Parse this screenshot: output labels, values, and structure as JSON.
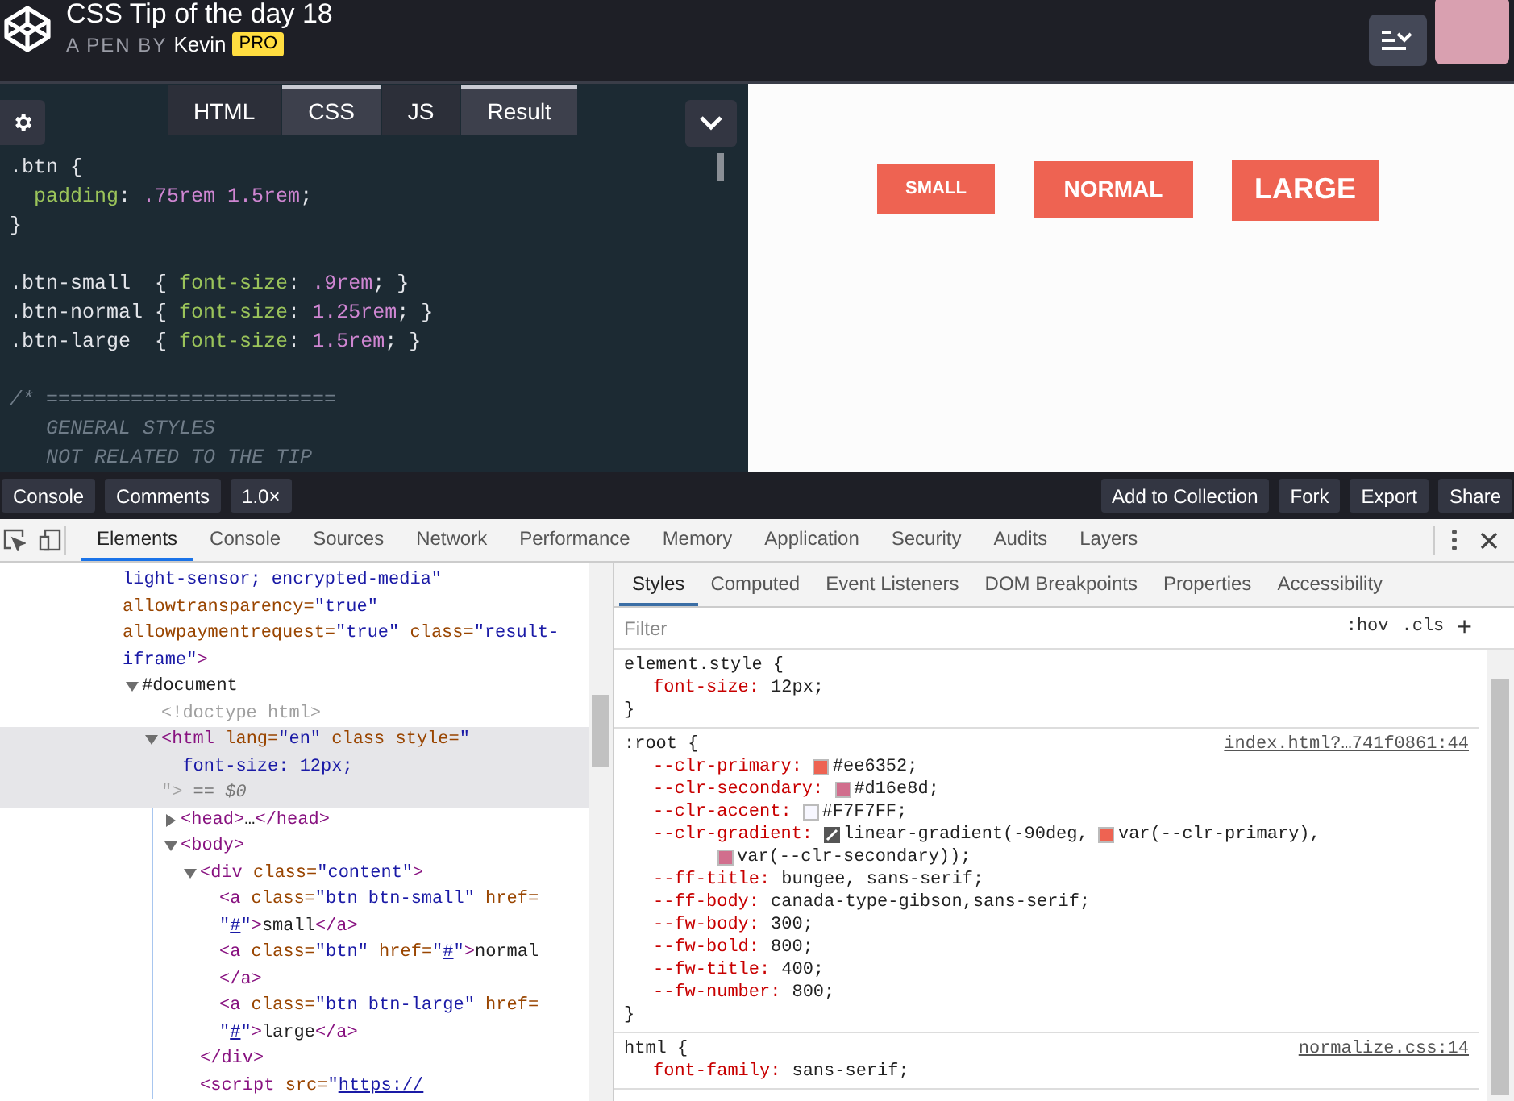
{
  "header": {
    "title": "CSS Tip of the day 18",
    "byline": "A PEN BY",
    "author": "Kevin",
    "badge": "PRO"
  },
  "editor": {
    "tabs": [
      {
        "label": "HTML",
        "selected": false
      },
      {
        "label": "CSS",
        "selected": true
      },
      {
        "label": "JS",
        "selected": false
      },
      {
        "label": "Result",
        "selected": true
      }
    ],
    "code": [
      {
        "tokens": [
          {
            "kind": "sel",
            "text": ".btn "
          },
          {
            "kind": "punct",
            "text": "{"
          }
        ]
      },
      {
        "tokens": [
          {
            "kind": "prop",
            "text": "  padding"
          },
          {
            "kind": "punct",
            "text": ": "
          },
          {
            "kind": "num",
            "text": ".75rem 1.5rem"
          },
          {
            "kind": "punct",
            "text": ";"
          }
        ]
      },
      {
        "tokens": [
          {
            "kind": "punct",
            "text": "}"
          }
        ]
      },
      {
        "kind": "blank"
      },
      {
        "tokens": [
          {
            "kind": "sel",
            "text": ".btn-small  "
          },
          {
            "kind": "punct",
            "text": "{ "
          },
          {
            "kind": "prop",
            "text": "font-size"
          },
          {
            "kind": "punct",
            "text": ": "
          },
          {
            "kind": "num",
            "text": ".9rem"
          },
          {
            "kind": "punct",
            "text": "; }"
          }
        ]
      },
      {
        "tokens": [
          {
            "kind": "sel",
            "text": ".btn-normal "
          },
          {
            "kind": "punct",
            "text": "{ "
          },
          {
            "kind": "prop",
            "text": "font-size"
          },
          {
            "kind": "punct",
            "text": ": "
          },
          {
            "kind": "num",
            "text": "1.25rem"
          },
          {
            "kind": "punct",
            "text": "; }"
          }
        ]
      },
      {
        "tokens": [
          {
            "kind": "sel",
            "text": ".btn-large  "
          },
          {
            "kind": "punct",
            "text": "{ "
          },
          {
            "kind": "prop",
            "text": "font-size"
          },
          {
            "kind": "punct",
            "text": ": "
          },
          {
            "kind": "num",
            "text": "1.5rem"
          },
          {
            "kind": "punct",
            "text": "; }"
          }
        ]
      },
      {
        "kind": "blank"
      },
      {
        "tokens": [
          {
            "kind": "comment",
            "text": "/* ========================"
          }
        ]
      },
      {
        "tokens": [
          {
            "kind": "comment",
            "text": "   GENERAL STYLES"
          }
        ]
      },
      {
        "tokens": [
          {
            "kind": "comment",
            "text": "   NOT RELATED TO THE TIP"
          }
        ]
      }
    ]
  },
  "result": {
    "buttons": [
      {
        "label": "SMALL",
        "kind": "small"
      },
      {
        "label": "NORMAL",
        "kind": "normal"
      },
      {
        "label": "LARGE",
        "kind": "large"
      }
    ]
  },
  "bar": {
    "left": [
      "Console",
      "Comments",
      "1.0×"
    ],
    "right": [
      "Add to Collection",
      "Fork",
      "Export",
      "Share"
    ]
  },
  "devtools": {
    "tabs": [
      {
        "label": "Elements",
        "selected": true
      },
      {
        "label": "Console",
        "selected": false
      },
      {
        "label": "Sources",
        "selected": false
      },
      {
        "label": "Network",
        "selected": false
      },
      {
        "label": "Performance",
        "selected": false
      },
      {
        "label": "Memory",
        "selected": false
      },
      {
        "label": "Application",
        "selected": false
      },
      {
        "label": "Security",
        "selected": false
      },
      {
        "label": "Audits",
        "selected": false
      },
      {
        "label": "Layers",
        "selected": false
      }
    ]
  },
  "elements": {
    "nodes": [
      {
        "lines": [
          [
            {
              "kind": "val",
              "text": "light-sensor; encrypted-media\""
            }
          ],
          [
            {
              "kind": "attr",
              "text": "allowtransparency="
            },
            {
              "kind": "val",
              "text": "\"true\""
            }
          ],
          [
            {
              "kind": "attr",
              "text": "allowpaymentrequest="
            },
            {
              "kind": "val",
              "text": "\"true\""
            },
            {
              "kind": "attr",
              "text": " class="
            },
            {
              "kind": "val",
              "text": "\"result-"
            }
          ],
          [
            {
              "kind": "val",
              "text": "iframe\""
            },
            {
              "kind": "tag",
              "text": ">"
            }
          ]
        ],
        "children": [
          {
            "expanded": true,
            "lines": [
              [
                {
                  "kind": "text",
                  "text": "#document"
                }
              ]
            ],
            "children": [
              {
                "lines": [
                  [
                    {
                      "kind": "dim",
                      "text": "<!doctype html>"
                    }
                  ]
                ]
              },
              {
                "expanded": true,
                "selected": true,
                "lines": [
                  [
                    {
                      "kind": "tag",
                      "text": "<html"
                    },
                    {
                      "kind": "attr",
                      "text": " lang="
                    },
                    {
                      "kind": "val",
                      "text": "\"en\""
                    },
                    {
                      "kind": "attr",
                      "text": " class style="
                    },
                    {
                      "kind": "val",
                      "text": "\""
                    }
                  ],
                  [
                    {
                      "kind": "val",
                      "text": "  font-size: 12px;"
                    }
                  ],
                  [
                    {
                      "kind": "dim",
                      "text": "\">"
                    },
                    {
                      "kind": "meta",
                      "text": " == $0"
                    }
                  ]
                ],
                "children": [
                  {
                    "expanded": false,
                    "lines": [
                      [
                        {
                          "kind": "tag",
                          "text": "<head>"
                        },
                        {
                          "kind": "text",
                          "text": "…"
                        },
                        {
                          "kind": "tag",
                          "text": "</head>"
                        }
                      ]
                    ]
                  },
                  {
                    "expanded": true,
                    "lines": [
                      [
                        {
                          "kind": "tag",
                          "text": "<body>"
                        }
                      ]
                    ],
                    "children": [
                      {
                        "expanded": true,
                        "lines": [
                          [
                            {
                              "kind": "tag",
                              "text": "<div"
                            },
                            {
                              "kind": "attr",
                              "text": " class="
                            },
                            {
                              "kind": "val",
                              "text": "\"content\""
                            },
                            {
                              "kind": "tag",
                              "text": ">"
                            }
                          ]
                        ],
                        "children": [
                          {
                            "lines": [
                              [
                                {
                                  "kind": "tag",
                                  "text": "<a"
                                },
                                {
                                  "kind": "attr",
                                  "text": " class="
                                },
                                {
                                  "kind": "val",
                                  "text": "\"btn btn-small\""
                                },
                                {
                                  "kind": "attr",
                                  "text": " href="
                                }
                              ],
                              [
                                {
                                  "kind": "val",
                                  "text": "\""
                                },
                                {
                                  "kind": "link",
                                  "text": "#"
                                },
                                {
                                  "kind": "val",
                                  "text": "\""
                                },
                                {
                                  "kind": "tag",
                                  "text": ">"
                                },
                                {
                                  "kind": "text",
                                  "text": "small"
                                },
                                {
                                  "kind": "tag",
                                  "text": "</a>"
                                }
                              ]
                            ]
                          },
                          {
                            "lines": [
                              [
                                {
                                  "kind": "tag",
                                  "text": "<a"
                                },
                                {
                                  "kind": "attr",
                                  "text": " class="
                                },
                                {
                                  "kind": "val",
                                  "text": "\"btn\""
                                },
                                {
                                  "kind": "attr",
                                  "text": " href="
                                },
                                {
                                  "kind": "val",
                                  "text": "\""
                                },
                                {
                                  "kind": "link",
                                  "text": "#"
                                },
                                {
                                  "kind": "val",
                                  "text": "\""
                                },
                                {
                                  "kind": "tag",
                                  "text": ">"
                                },
                                {
                                  "kind": "text",
                                  "text": "normal"
                                }
                              ],
                              [
                                {
                                  "kind": "tag",
                                  "text": "</a>"
                                }
                              ]
                            ]
                          },
                          {
                            "lines": [
                              [
                                {
                                  "kind": "tag",
                                  "text": "<a"
                                },
                                {
                                  "kind": "attr",
                                  "text": " class="
                                },
                                {
                                  "kind": "val",
                                  "text": "\"btn btn-large\""
                                },
                                {
                                  "kind": "attr",
                                  "text": " href="
                                }
                              ],
                              [
                                {
                                  "kind": "val",
                                  "text": "\""
                                },
                                {
                                  "kind": "link",
                                  "text": "#"
                                },
                                {
                                  "kind": "val",
                                  "text": "\""
                                },
                                {
                                  "kind": "tag",
                                  "text": ">"
                                },
                                {
                                  "kind": "text",
                                  "text": "large"
                                },
                                {
                                  "kind": "tag",
                                  "text": "</a>"
                                }
                              ]
                            ]
                          }
                        ],
                        "closing": [
                          {
                            "kind": "tag",
                            "text": "</div>"
                          }
                        ]
                      },
                      {
                        "lines": [
                          [
                            {
                              "kind": "tag",
                              "text": "<script"
                            },
                            {
                              "kind": "attr",
                              "text": " src="
                            },
                            {
                              "kind": "val",
                              "text": "\""
                            },
                            {
                              "kind": "link",
                              "text": "https://"
                            }
                          ]
                        ]
                      }
                    ]
                  }
                ]
              }
            ]
          }
        ]
      }
    ]
  },
  "styles": {
    "tabs": [
      {
        "label": "Styles",
        "selected": true
      },
      {
        "label": "Computed",
        "selected": false
      },
      {
        "label": "Event Listeners",
        "selected": false
      },
      {
        "label": "DOM Breakpoints",
        "selected": false
      },
      {
        "label": "Properties",
        "selected": false
      },
      {
        "label": "Accessibility",
        "selected": false
      }
    ],
    "filter_placeholder": "Filter",
    "hov": ":hov",
    "cls": ".cls",
    "add": "+",
    "rules": [
      {
        "selector": "element.style {",
        "close": "}",
        "decls": [
          {
            "prop": "font-size:",
            "value": [
              [
                {
                  "kind": "text",
                  "text": "12px;"
                }
              ]
            ]
          }
        ]
      },
      {
        "selector": ":root {",
        "source": "index.html?…741f0861:44",
        "close": "}",
        "decls": [
          {
            "prop": "--clr-primary:",
            "value": [
              [
                {
                  "kind": "swatch",
                  "color": "#ee6352"
                },
                {
                  "kind": "text",
                  "text": "#ee6352;"
                }
              ]
            ]
          },
          {
            "prop": "--clr-secondary:",
            "value": [
              [
                {
                  "kind": "swatch",
                  "color": "#d16e8d"
                },
                {
                  "kind": "text",
                  "text": "#d16e8d;"
                }
              ]
            ]
          },
          {
            "prop": "--clr-accent:",
            "value": [
              [
                {
                  "kind": "swatch",
                  "color": "#f7f7ff"
                },
                {
                  "kind": "text",
                  "text": "#F7F7FF;"
                }
              ]
            ]
          },
          {
            "prop": "--clr-gradient:",
            "value": [
              [
                {
                  "kind": "gradient"
                },
                {
                  "kind": "text",
                  "text": "linear-gradient(-90deg, "
                },
                {
                  "kind": "swatch",
                  "color": "#ee6352"
                },
                {
                  "kind": "text",
                  "text": "var(--clr-primary),"
                }
              ],
              [
                {
                  "kind": "swatch",
                  "color": "#d16e8d"
                },
                {
                  "kind": "text",
                  "text": "var(--clr-secondary));"
                }
              ]
            ]
          },
          {
            "prop": "--ff-title:",
            "value": [
              [
                {
                  "kind": "text",
                  "text": "bungee, sans-serif;"
                }
              ]
            ]
          },
          {
            "prop": "--ff-body:",
            "value": [
              [
                {
                  "kind": "text",
                  "text": "canada-type-gibson,sans-serif;"
                }
              ]
            ]
          },
          {
            "prop": "--fw-body:",
            "value": [
              [
                {
                  "kind": "text",
                  "text": "300;"
                }
              ]
            ]
          },
          {
            "prop": "--fw-bold:",
            "value": [
              [
                {
                  "kind": "text",
                  "text": "800;"
                }
              ]
            ]
          },
          {
            "prop": "--fw-title:",
            "value": [
              [
                {
                  "kind": "text",
                  "text": "400;"
                }
              ]
            ]
          },
          {
            "prop": "--fw-number:",
            "value": [
              [
                {
                  "kind": "text",
                  "text": "800;"
                }
              ]
            ]
          }
        ]
      },
      {
        "selector": "html {",
        "source": "normalize.css:14",
        "decls": [
          {
            "prop": "font-family:",
            "value": [
              [
                {
                  "kind": "text",
                  "text": "sans-serif;"
                }
              ]
            ]
          }
        ]
      }
    ]
  }
}
